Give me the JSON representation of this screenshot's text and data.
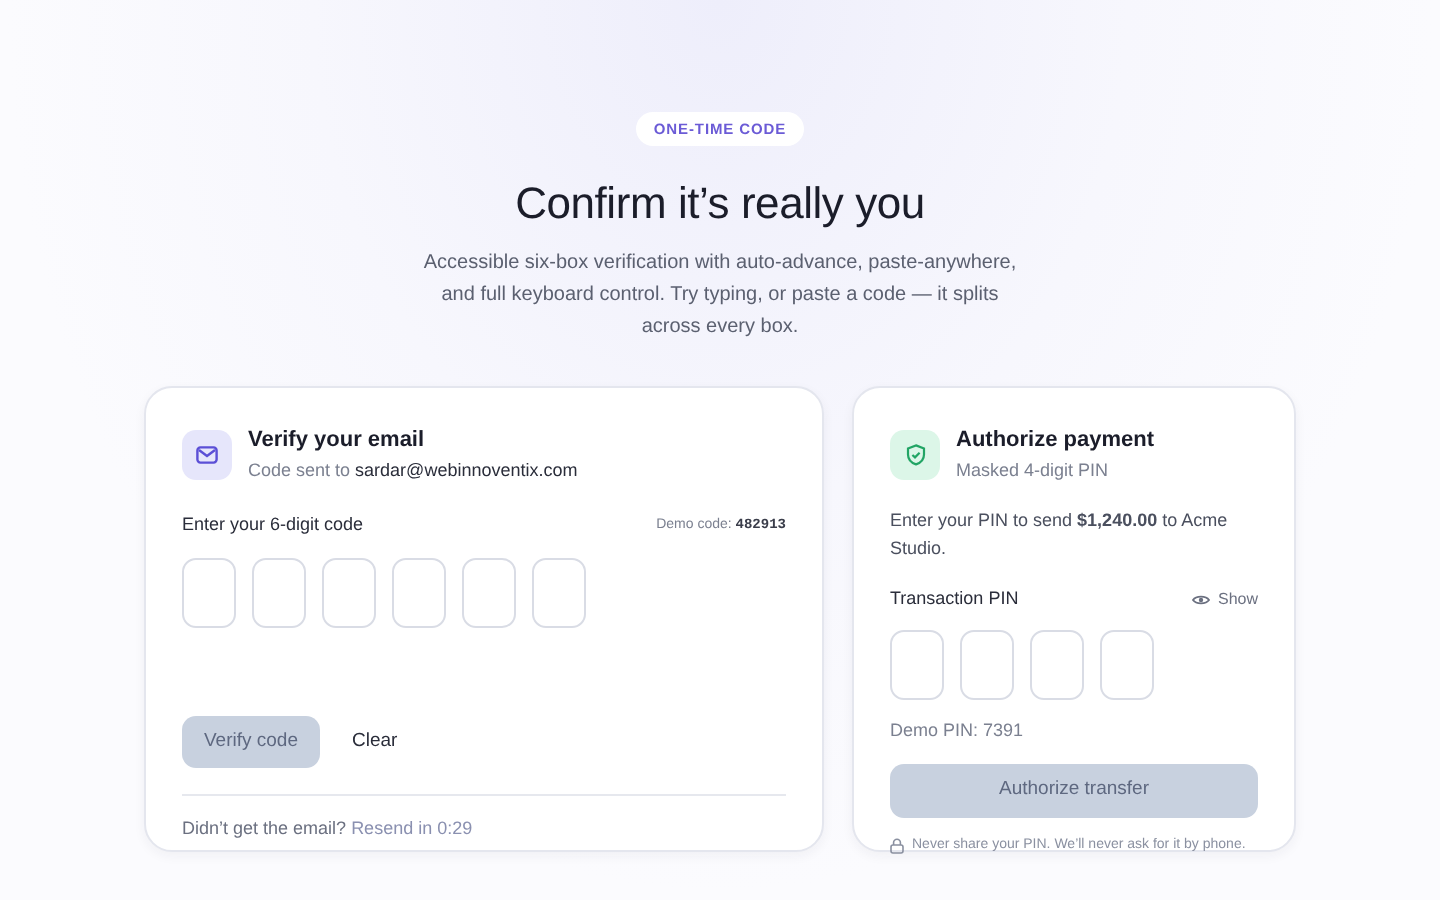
{
  "badge": "ONE-TIME CODE",
  "title": "Confirm it’s really you",
  "subtitle": "Accessible six-box verification with auto-advance, paste-anywhere, and full keyboard control. Try typing, or paste a code — it splits across every box.",
  "email_card": {
    "title": "Verify your email",
    "subtitle": "Code sent to **sardar@webinnoventix.com**",
    "label": "Enter your 6-digit code",
    "demo_label": "Demo code:",
    "demo_code": "482913",
    "boxes": [
      {
        "filled": false
      },
      {
        "filled": false
      },
      {
        "filled": false
      },
      {
        "filled": false
      },
      {
        "filled": false
      },
      {
        "filled": false
      }
    ],
    "verify_button": {
      "label": "Verify code",
      "disabled": true
    },
    "clear_button": "Clear",
    "footer": "Didn’t get the email?",
    "resend": {
      "label": "Resend in 0:29",
      "disabled": true
    }
  },
  "payment_card": {
    "title": "Authorize payment",
    "subtitle": "Masked 4-digit PIN",
    "description": "Enter your PIN to send **$1,240.00** to Acme Studio.",
    "pin_label": "Transaction PIN",
    "show_toggle": "Show",
    "boxes": [
      {
        "filled": false
      },
      {
        "filled": false
      },
      {
        "filled": false
      },
      {
        "filled": false
      }
    ],
    "demo": "Demo PIN: 7391",
    "authorize_button": {
      "label": "Authorize transfer",
      "disabled": true
    },
    "note": "Never share your PIN. We’ll never ask for it by phone."
  }
}
